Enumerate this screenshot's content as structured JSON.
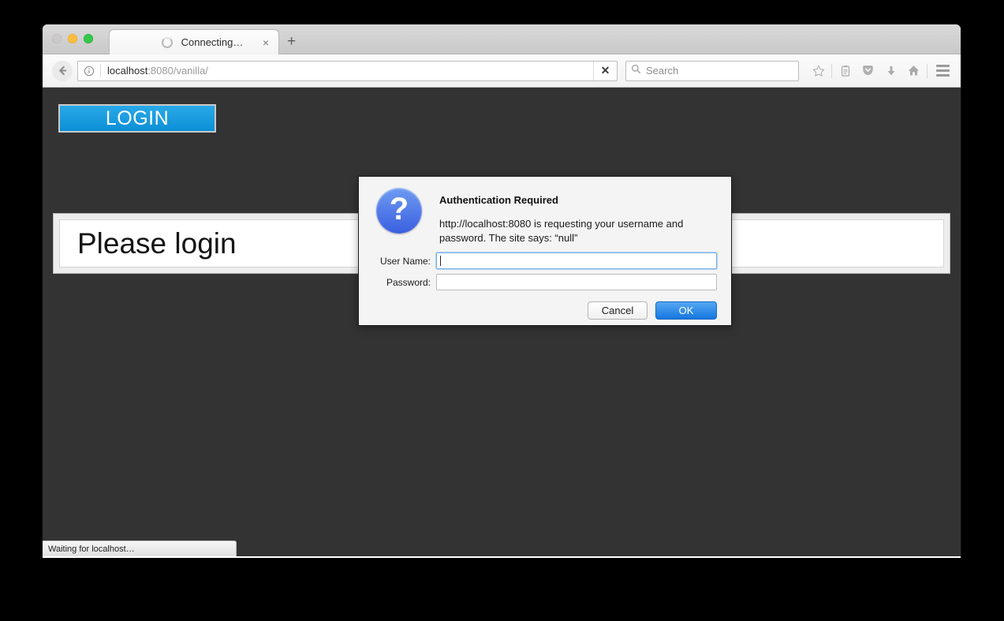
{
  "window": {
    "traffic_lights": [
      "close",
      "minimize",
      "maximize"
    ]
  },
  "tabbar": {
    "tab_title": "Connecting…",
    "close_label": "×",
    "newtab_label": "+",
    "spinner_icon": "loading-spinner-icon"
  },
  "navbar": {
    "back_icon": "back-arrow-icon",
    "identity_icon": "info-circle-icon",
    "url_host": "localhost",
    "url_path": ":8080/vanilla/",
    "url_full": "localhost:8080/vanilla/",
    "stop_label": "✕",
    "search_placeholder": "Search",
    "search_icon": "search-icon",
    "icons": [
      {
        "name": "bookmark-star-icon",
        "glyph": "☆"
      },
      {
        "name": "reader-list-icon",
        "glyph": "὜b"
      },
      {
        "name": "pocket-shield-icon",
        "glyph": "⬤"
      },
      {
        "name": "download-arrow-icon",
        "glyph": "⬇"
      },
      {
        "name": "home-icon",
        "glyph": "⌂"
      }
    ],
    "menu_icon": "hamburger-menu-icon"
  },
  "page": {
    "login_button_label": "LOGIN",
    "headline": "Please login",
    "background_color": "#333333",
    "login_button_color": "#0c8fd6"
  },
  "statusbar": {
    "text": "Waiting for localhost…"
  },
  "dialog": {
    "icon": "question-mark-icon",
    "title": "Authentication Required",
    "message": "http://localhost:8080 is requesting your username and password. The site says: “null”",
    "fields": [
      {
        "label": "User Name:",
        "value": "",
        "focused": true
      },
      {
        "label": "Password:",
        "value": "",
        "focused": false
      }
    ],
    "cancel_label": "Cancel",
    "ok_label": "OK",
    "ok_color": "#1577e0"
  }
}
